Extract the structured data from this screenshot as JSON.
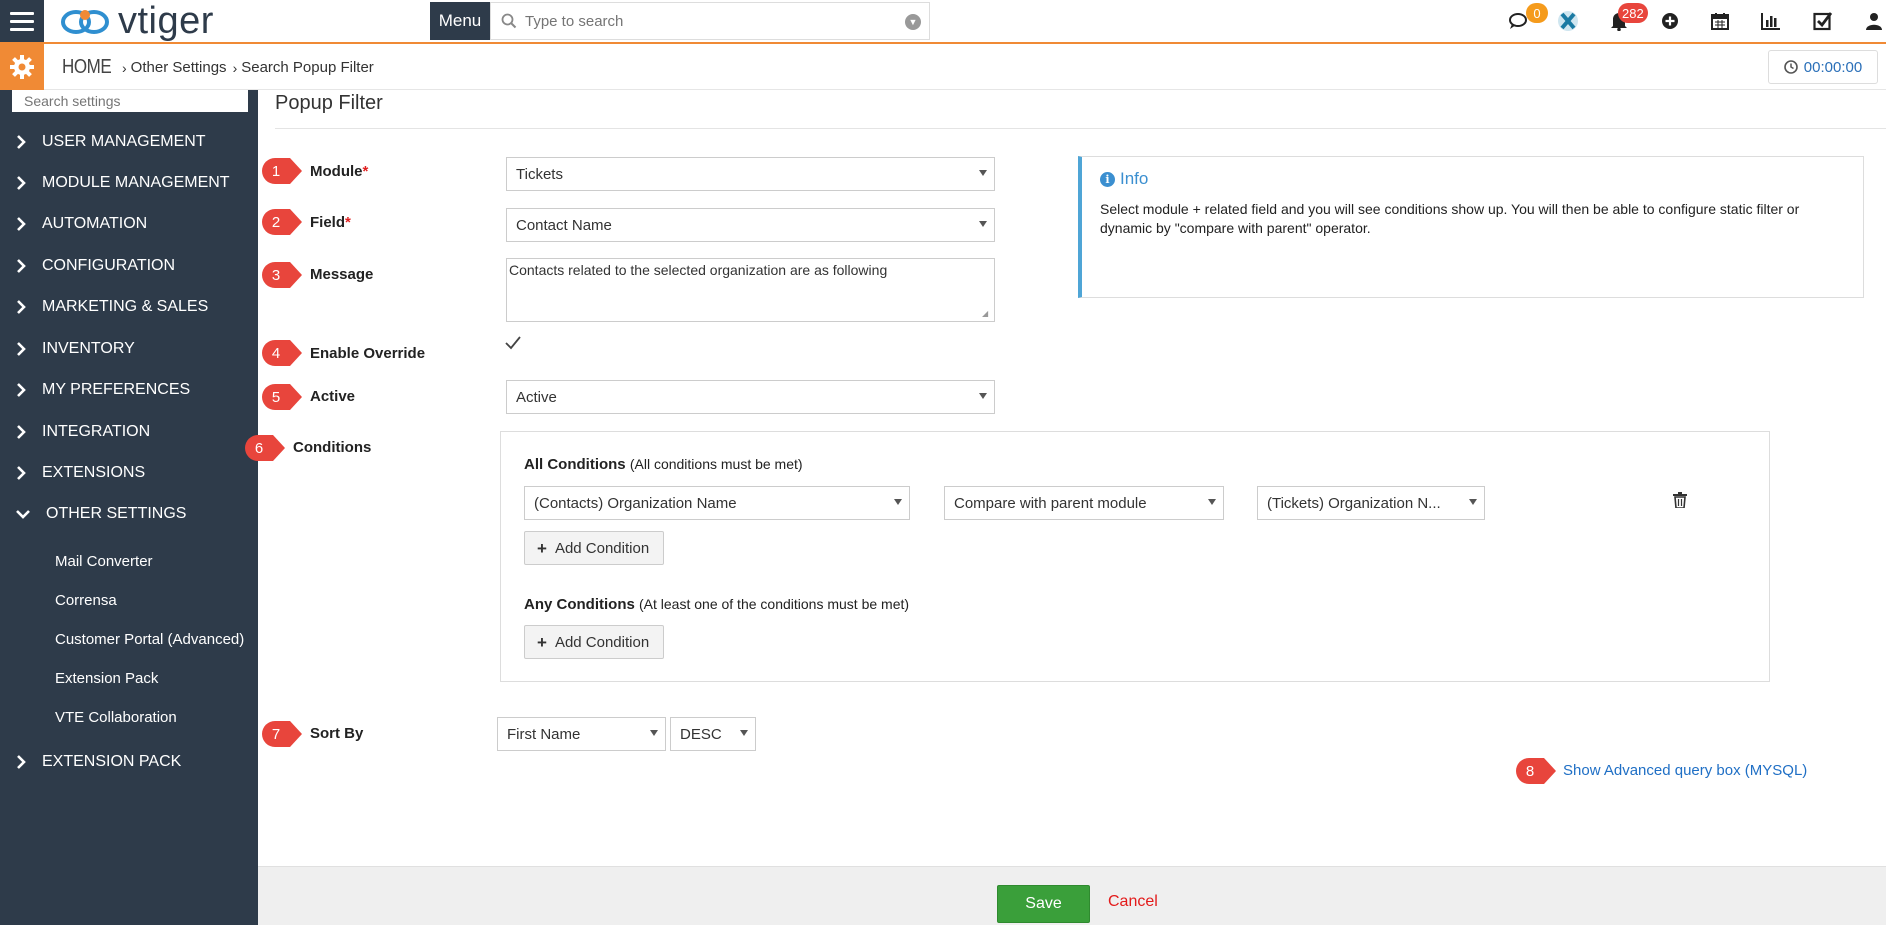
{
  "topbar": {
    "logo_text": "vtiger",
    "menu_label": "Menu",
    "search_placeholder": "Type to search",
    "chat_badge": "0",
    "notifications_badge": "282",
    "colors": {
      "topbar_accent": "#f08a35",
      "dark": "#2e3b4a",
      "chat_badge": "#f59b1c",
      "notif_badge": "#e8453c"
    }
  },
  "breadcrumb": {
    "home": "HOME",
    "level1": "Other Settings",
    "level2": "Search Popup Filter"
  },
  "timer": "00:00:00",
  "sidebar": {
    "search_placeholder": "Search settings",
    "items": [
      {
        "label": "USER MANAGEMENT"
      },
      {
        "label": "MODULE MANAGEMENT"
      },
      {
        "label": "AUTOMATION"
      },
      {
        "label": "CONFIGURATION"
      },
      {
        "label": "MARKETING & SALES"
      },
      {
        "label": "INVENTORY"
      },
      {
        "label": "MY PREFERENCES"
      },
      {
        "label": "INTEGRATION"
      },
      {
        "label": "EXTENSIONS"
      },
      {
        "label": "OTHER SETTINGS"
      },
      {
        "label": "EXTENSION PACK"
      }
    ],
    "sub_items": [
      {
        "label": "Mail Converter"
      },
      {
        "label": "Corrensa"
      },
      {
        "label": "Customer Portal (Advanced)"
      },
      {
        "label": "Extension Pack"
      },
      {
        "label": "VTE Collaboration"
      }
    ]
  },
  "page": {
    "title": "Popup Filter"
  },
  "markers": [
    "1",
    "2",
    "3",
    "4",
    "5",
    "6",
    "7",
    "8"
  ],
  "form": {
    "module_label": "Module",
    "module_value": "Tickets",
    "field_label": "Field",
    "field_value": "Contact Name",
    "required_mark": "*",
    "message_label": "Message",
    "message_value": "Contacts related to the selected organization are as following",
    "override_label": "Enable Override",
    "override_checked": true,
    "active_label": "Active",
    "active_value": "Active",
    "conditions_label": "Conditions",
    "sortby_label": "Sort By",
    "sort_field": "First Name",
    "sort_order": "DESC"
  },
  "info": {
    "title": "Info",
    "text": "Select module + related field and you will see conditions show up. You will then be able to configure static filter or dynamic by \"compare with parent\" operator."
  },
  "conditions": {
    "all_title": "All Conditions",
    "all_hint": "(All conditions must be met)",
    "row": {
      "field": "(Contacts) Organization Name",
      "operator": "Compare with parent module",
      "value": "(Tickets) Organization N..."
    },
    "add_label": "Add Condition",
    "any_title": "Any Conditions",
    "any_hint": "(At least one of the conditions must be met)"
  },
  "advanced_link": "Show Advanced query box (MYSQL)",
  "footer": {
    "save_label": "Save",
    "cancel_label": "Cancel"
  }
}
